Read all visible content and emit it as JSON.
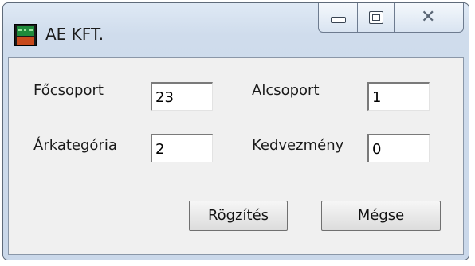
{
  "window": {
    "title": "AE KFT.",
    "buttons": {
      "minimize": "minimize",
      "maximize": "maximize",
      "close": "close"
    }
  },
  "form": {
    "focsoport": {
      "label": "Főcsoport",
      "value": "23"
    },
    "alcsoport": {
      "label": "Alcsoport",
      "value": "1"
    },
    "arkategoria": {
      "label": "Árkategória",
      "value": "2"
    },
    "kedvezmeny": {
      "label": "Kedvezmény",
      "value": "0"
    }
  },
  "actions": {
    "save": {
      "mnemonic": "R",
      "rest": "ögzítés"
    },
    "cancel": {
      "mnemonic": "M",
      "rest": "égse"
    }
  },
  "colors": {
    "title_bar": "#cfdcec",
    "client_bg": "#f0f0f0",
    "icon_green": "#1f8a3b",
    "icon_red": "#c84a1c"
  }
}
